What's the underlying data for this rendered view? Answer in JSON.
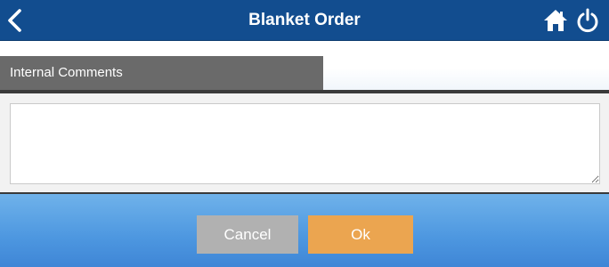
{
  "header": {
    "title": "Blanket Order",
    "back_icon": "chevron-left-icon",
    "home_icon": "home-icon",
    "power_icon": "power-icon"
  },
  "section": {
    "label": "Internal Comments"
  },
  "comments": {
    "value": "",
    "placeholder": ""
  },
  "footer": {
    "cancel_label": "Cancel",
    "ok_label": "Ok"
  },
  "colors": {
    "header_bg": "#124d8f",
    "section_tab_bg": "#6a6a6a",
    "footer_gradient_top": "#6fb2ea",
    "footer_gradient_bottom": "#3f86d6",
    "cancel_bg": "#b1b1b1",
    "ok_bg": "#eba550"
  }
}
